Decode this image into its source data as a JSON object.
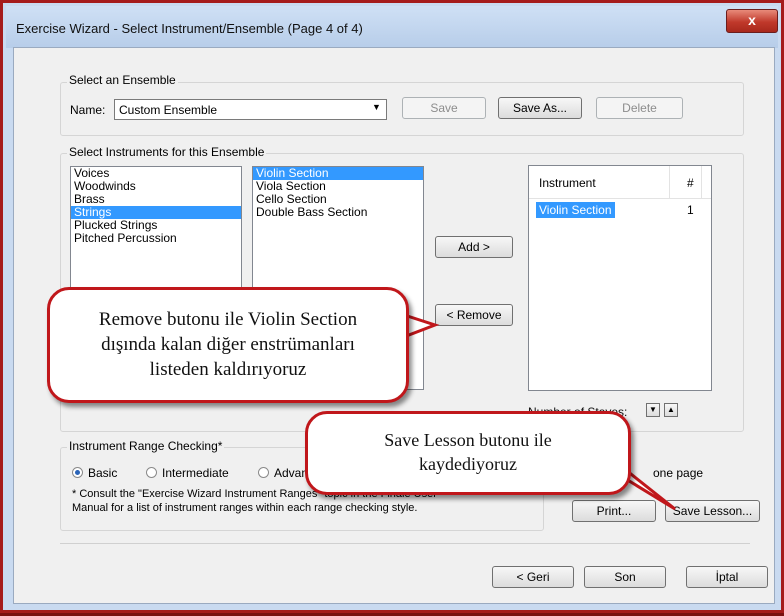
{
  "window": {
    "title": "Exercise Wizard - Select Instrument/Ensemble (Page 4 of 4)",
    "close_label": "x"
  },
  "ensemble": {
    "group_label": "Select an Ensemble",
    "name_label": "Name:",
    "name_value": "Custom Ensemble",
    "save_label": "Save",
    "save_as_label": "Save As...",
    "delete_label": "Delete"
  },
  "instruments": {
    "group_label": "Select Instruments for this Ensemble",
    "families": [
      "Voices",
      "Woodwinds",
      "Brass",
      "Strings",
      "Plucked Strings",
      "Pitched Percussion"
    ],
    "selected_family": "Strings",
    "instruments": [
      "Violin Section",
      "Viola Section",
      "Cello Section",
      "Double Bass Section"
    ],
    "selected_instrument": "Violin Section",
    "add_label": "Add >",
    "remove_label": "< Remove",
    "table_headers": [
      "Instrument",
      "#"
    ],
    "table_rows": [
      {
        "instrument": "Violin Section",
        "count": "1"
      }
    ],
    "staves_label": "Number of Staves:"
  },
  "range_checking": {
    "group_label": "Instrument Range Checking*",
    "options": [
      "Basic",
      "Intermediate",
      "Advanced"
    ],
    "selected": "Basic",
    "footnote_line1": "* Consult the \"Exercise Wizard Instrument Ranges\" topic in the Finale User",
    "footnote_line2": "Manual for a list of instrument ranges within each range checking style."
  },
  "options_right": {
    "one_page_label": "one page",
    "print_label": "Print...",
    "save_lesson_label": "Save Lesson..."
  },
  "footer": {
    "back_label": "< Geri",
    "finish_label": "Son",
    "cancel_label": "İptal"
  },
  "callouts": {
    "remove_line1": "Remove butonu ile Violin Section",
    "remove_line2": "dışında kalan diğer enstrümanları",
    "remove_line3": "listeden kaldırıyoruz",
    "save_line1": "Save Lesson butonu ile",
    "save_line2": "kaydediyoruz"
  },
  "colors": {
    "border_accent": "#a51b1b",
    "selection": "#3399ff",
    "callout_border": "#c0171b"
  }
}
